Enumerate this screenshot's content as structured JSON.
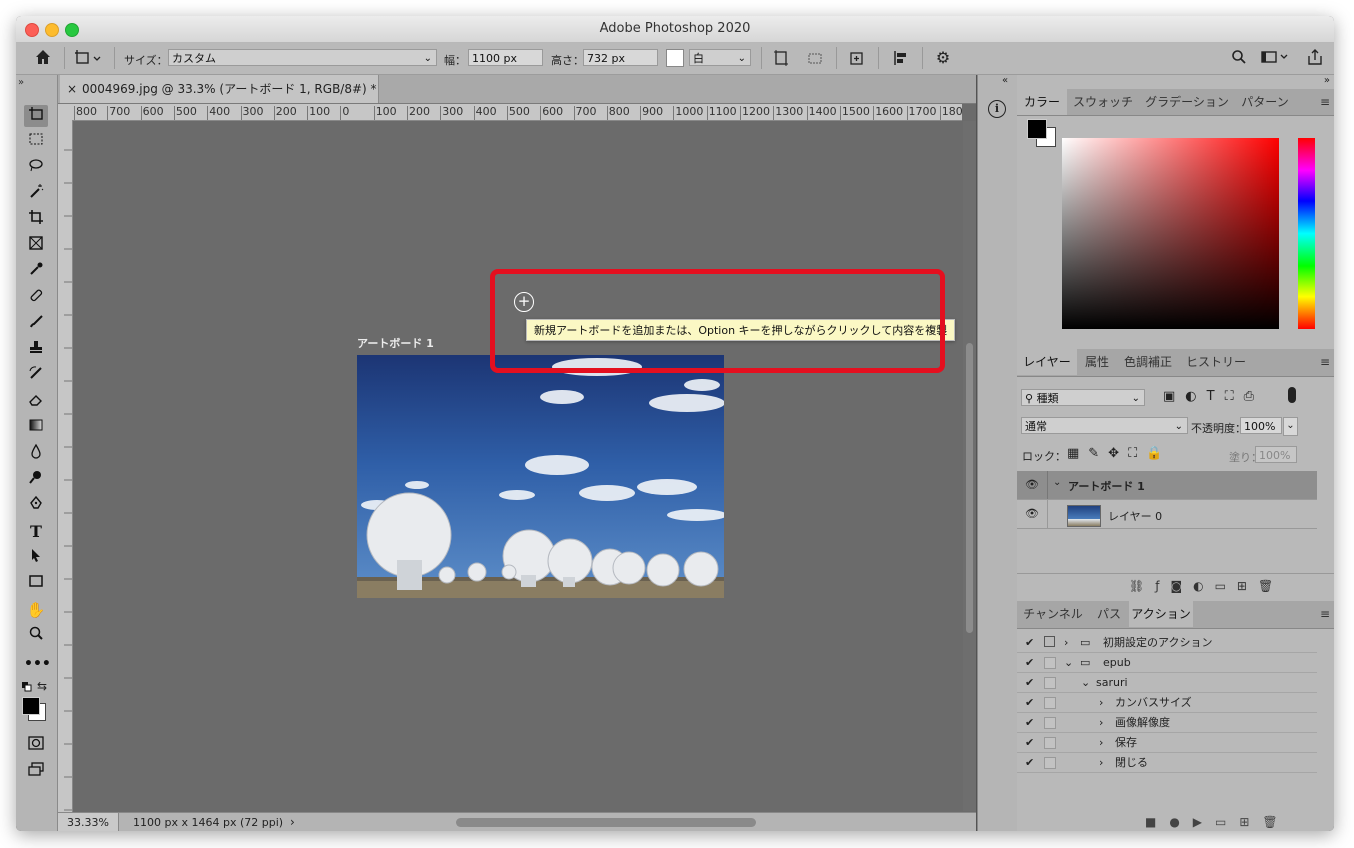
{
  "window": {
    "title": "Adobe Photoshop 2020"
  },
  "options_bar": {
    "size_label": "サイズ：",
    "size_value": "カスタム",
    "width_label": "幅：",
    "width_value": "1100 px",
    "height_label": "高さ：",
    "height_value": "732 px",
    "bg_value": "白"
  },
  "document": {
    "tab_close": "×",
    "tab_title": "0004969.jpg @ 33.3% (アートボード 1, RGB/8#) *",
    "artboard_label": "アートボード 1",
    "tooltip": "新規アートボードを追加または、Option キーを押しながらクリックして内容を複製",
    "ruler_h": [
      "800",
      "700",
      "600",
      "500",
      "400",
      "300",
      "200",
      "100",
      "0",
      "100",
      "200",
      "300",
      "400",
      "500",
      "600",
      "700",
      "800",
      "900",
      "1000",
      "1100",
      "1200",
      "1300",
      "1400",
      "1500",
      "1600",
      "1700",
      "180"
    ],
    "status_zoom": "33.33%",
    "status_info": "1100 px x 1464 px (72 ppi)"
  },
  "color_panel": {
    "tabs": [
      "カラー",
      "スウォッチ",
      "グラデーション",
      "パターン"
    ],
    "foreground": "#000000",
    "background": "#ffffff",
    "hue_color": "#ff0000"
  },
  "layers_panel": {
    "tabs": [
      "レイヤー",
      "属性",
      "色調補正",
      "ヒストリー"
    ],
    "filter_label": "種類",
    "blend_mode": "通常",
    "opacity_label": "不透明度：",
    "opacity_value": "100%",
    "lock_label": "ロック：",
    "fill_label": "塗り：",
    "fill_value": "100%",
    "layers": [
      {
        "name": "アートボード 1",
        "type": "artboard"
      },
      {
        "name": "レイヤー 0",
        "type": "layer"
      }
    ]
  },
  "actions_panel": {
    "tabs": [
      "チャンネル",
      "パス",
      "アクション"
    ],
    "rows": [
      {
        "label": "初期設定のアクション",
        "indent": 0,
        "folder": true,
        "expanded": false
      },
      {
        "label": "epub",
        "indent": 0,
        "folder": true,
        "expanded": true
      },
      {
        "label": "saruri",
        "indent": 1,
        "folder": false,
        "expanded": true
      },
      {
        "label": "カンバスサイズ",
        "indent": 2,
        "folder": false,
        "expanded": false
      },
      {
        "label": "画像解像度",
        "indent": 2,
        "folder": false,
        "expanded": false
      },
      {
        "label": "保存",
        "indent": 2,
        "folder": false,
        "expanded": false
      },
      {
        "label": "閉じる",
        "indent": 2,
        "folder": false,
        "expanded": false
      }
    ]
  },
  "icons": {
    "home": "home-icon",
    "artboard_tool": "artboard-tool-icon",
    "search": "search-icon",
    "info": "info-icon"
  }
}
